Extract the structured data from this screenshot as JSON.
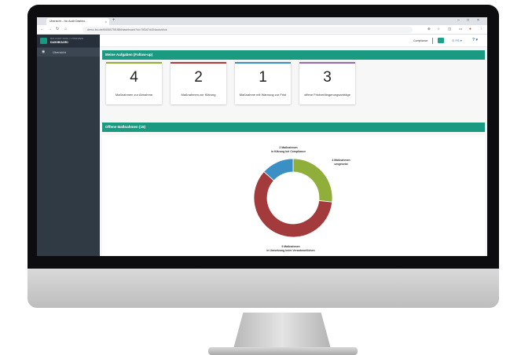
{
  "browser": {
    "tab_title": "Übersicht – bio Audit Dashbo…",
    "tab_close": "×",
    "new_tab": "+",
    "url": "demo.bio.de/6/606075f1f86f/dashboard?lcl=7f8167d404auto/click",
    "icons": {
      "back": "back-arrow-icon",
      "forward": "forward-arrow-icon",
      "reload": "reload-icon",
      "home": "home-icon"
    }
  },
  "sidebar": {
    "brand_line1": "BIO AUDIT DATA | V PREVIEW",
    "brand_line2": "DASHBOARD",
    "items": [
      {
        "label": "Übersicht",
        "icon": "dashboard-icon"
      }
    ]
  },
  "topbar": {
    "role": "Compliance",
    "user_label": "FS",
    "help_label": "?"
  },
  "tasks": {
    "title": "Meine Aufgaben (Follow-up)",
    "cards": [
      {
        "count": "4",
        "label": "Maßnahmen zur Abnahme",
        "color": "#8fae3a"
      },
      {
        "count": "2",
        "label": "Maßnahmen zur Klärung",
        "color": "#b23a3a"
      },
      {
        "count": "1",
        "label": "Maßnahme mit Warnung zur Frist",
        "color": "#3a8fc4"
      },
      {
        "count": "3",
        "label": "offene Fristverlängerungsanträge",
        "color": "#9a6ab0"
      }
    ]
  },
  "open_measures": {
    "title": "Offene Maßnahmen (15)"
  },
  "chart_data": {
    "type": "pie",
    "categories": [
      "Maßnahmen umgesetzt",
      "Maßnahmen in Umsetzung beim Verantwortlichen",
      "Maßnahmen in Klärung bei Compliance"
    ],
    "values": [
      4,
      9,
      2
    ],
    "colors": [
      "#8fae3a",
      "#a33a3c",
      "#3a8fc4"
    ],
    "labels": [
      [
        "4 Maßnahmen",
        "umgesetzt"
      ],
      [
        "9 Maßnahmen",
        "in Umsetzung beim Verantwortlichen"
      ],
      [
        "2 Maßnahmen",
        "in Klärung bei Compliance"
      ]
    ],
    "donut": true
  }
}
